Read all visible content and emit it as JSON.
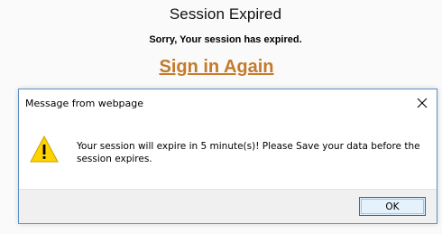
{
  "page": {
    "title": "Session Expired",
    "subtitle": "Sorry, Your session has expired.",
    "signin_link": "Sign in Again",
    "link_color": "#c47a2a"
  },
  "dialog": {
    "title": "Message from webpage",
    "close_icon": "close-icon",
    "warning_icon": "warning-icon",
    "message": "Your session will expire in 5 minute(s)! Please Save your data before the session expires.",
    "ok_label": "OK",
    "border_color": "#5b8fc9",
    "button_accent": "#0078d7"
  }
}
